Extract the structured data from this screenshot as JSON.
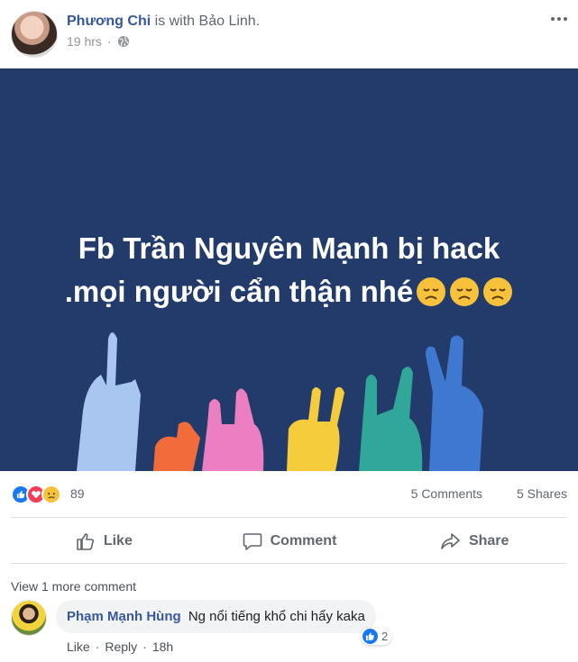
{
  "post": {
    "author": "Phương Chi",
    "with_text": "is with Bảo Linh.",
    "time": "19 hrs",
    "dot": "·",
    "image_text_line1": "Fb Trần Nguyên Mạnh bị hack",
    "image_text_line2": ".mọi người cẩn thận nhé",
    "image_bg_color": "#233b6b"
  },
  "reactions": {
    "icons": [
      "like-reaction-icon",
      "love-reaction-icon",
      "sad-reaction-icon"
    ],
    "count": "89",
    "comments": "5 Comments",
    "shares": "5 Shares"
  },
  "actions": {
    "like": "Like",
    "comment": "Comment",
    "share": "Share"
  },
  "comments": {
    "view_more": "View 1 more comment",
    "items": [
      {
        "name": "Phạm Mạnh Hùng",
        "text": "Ng nổi tiếng khổ chi hẩy kaka",
        "like": "Like",
        "reply": "Reply",
        "time": "18h",
        "likes": "2"
      }
    ]
  },
  "colors": {
    "link": "#365899",
    "like_blue": "#1877f2",
    "love_red": "#f33e58",
    "sad_yellow": "#f7c23b"
  }
}
